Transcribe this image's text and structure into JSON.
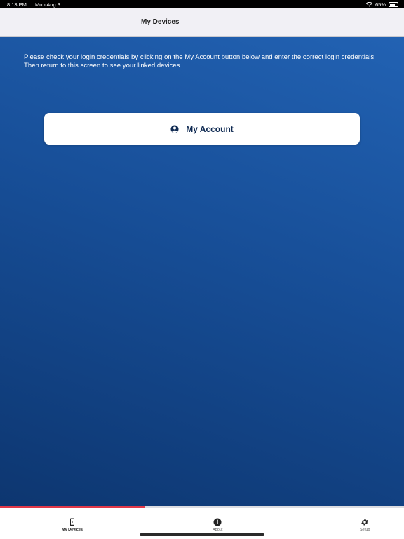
{
  "status_bar": {
    "time": "8:13 PM",
    "date": "Mon Aug 3",
    "battery": "65%",
    "wifi_icon": "wifi-icon",
    "battery_icon": "battery-icon"
  },
  "nav": {
    "title": "My Devices"
  },
  "content": {
    "message": "Please check your login credentials by clicking on the My Account button below and enter the correct login credentials. Then return to this screen to see your linked devices.",
    "account_button": {
      "label": "My Account",
      "icon": "account-circle-icon"
    }
  },
  "progress": {
    "fraction": 0.36,
    "color": "#e23848"
  },
  "tabs": [
    {
      "label": "My Devices",
      "icon": "phone-device-icon",
      "active": true
    },
    {
      "label": "About",
      "icon": "info-icon",
      "active": false
    },
    {
      "label": "Setup",
      "icon": "gear-icon",
      "active": false
    }
  ],
  "colors": {
    "accent": "#e23848",
    "brand_blue": "#174e97",
    "button_text": "#0f2a52"
  }
}
